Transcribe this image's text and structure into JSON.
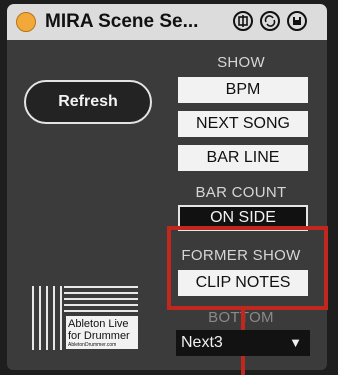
{
  "window": {
    "title": "MIRA Scene Se...",
    "icons": [
      "link-icon",
      "refresh-cycle-icon",
      "save-icon"
    ]
  },
  "refresh_button": {
    "label": "Refresh"
  },
  "show": {
    "label": "SHOW",
    "buttons": [
      "BPM",
      "NEXT SONG",
      "BAR LINE"
    ]
  },
  "bar_count": {
    "label": "BAR COUNT",
    "value": "ON SIDE"
  },
  "former_show": {
    "label": "FORMER SHOW",
    "button": "CLIP NOTES"
  },
  "bottom": {
    "label": "BOTTOM",
    "selected": "Next3",
    "arrow": "▼"
  },
  "logo": {
    "line1": "Ableton Live",
    "line2": "for Drummer",
    "url": "AbletonDrummer.com"
  },
  "colors": {
    "accent_orange": "#f3a93a",
    "highlight_red": "#c0281e",
    "panel_bg": "#3b3b3b",
    "titlebar_bg": "#dcdcdc"
  }
}
